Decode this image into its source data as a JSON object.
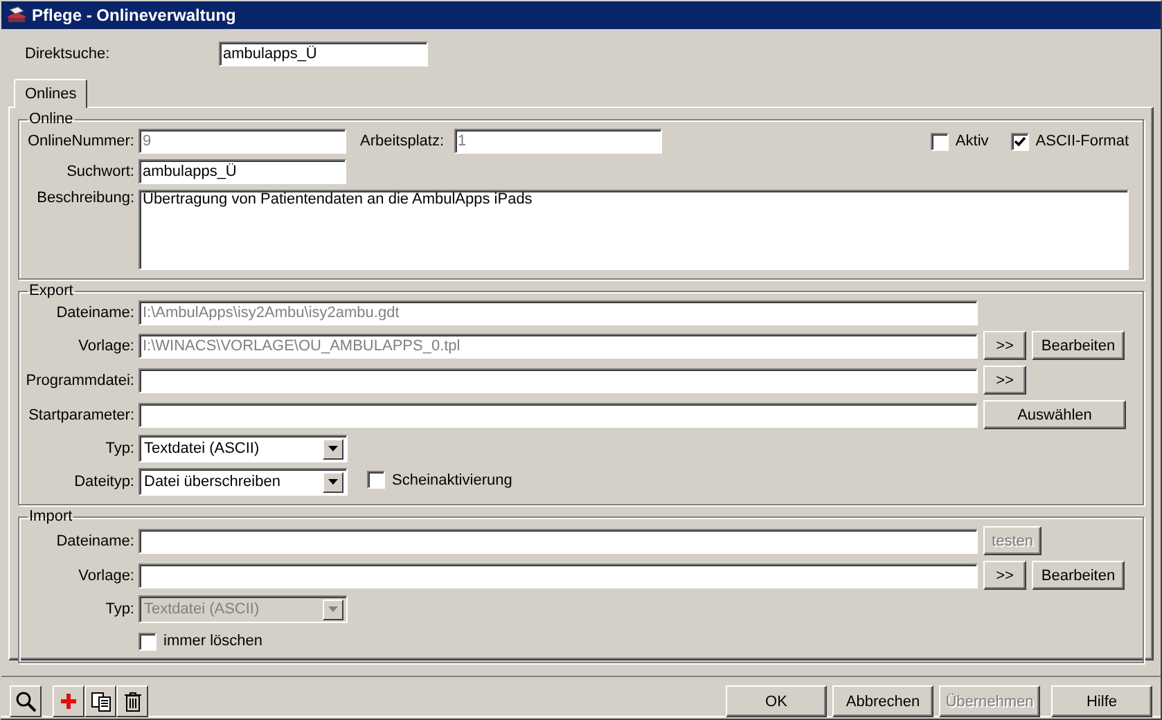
{
  "window": {
    "title": "Pflege - Onlineverwaltung"
  },
  "direct_search": {
    "label": "Direktsuche:",
    "value": "ambulapps_Ü"
  },
  "tabs": [
    {
      "label": "Onlines",
      "selected": true
    }
  ],
  "online": {
    "title": "Online",
    "number": {
      "label": "OnlineNummer:",
      "value": "9",
      "disabled": true
    },
    "workplace": {
      "label": "Arbeitsplatz:",
      "value": "1",
      "disabled": true
    },
    "checkboxes": [
      {
        "label": "Aktiv",
        "checked": false
      },
      {
        "label": "ASCII-Format",
        "checked": true
      }
    ],
    "keyword": {
      "label": "Suchwort:",
      "value": "ambulapps_Ü",
      "disabled": false
    },
    "description": {
      "label": "Beschreibung:",
      "value": "Übertragung von Patientendaten an die AmbulApps iPads"
    }
  },
  "export": {
    "title": "Export",
    "rows": [
      {
        "kind": "text",
        "label": "Dateiname:",
        "value": "I:\\AmbulApps\\isy2Ambu\\isy2ambu.gdt",
        "disabled": true,
        "buttons": []
      },
      {
        "kind": "text",
        "label": "Vorlage:",
        "value": "I:\\WINACS\\VORLAGE\\OU_AMBULAPPS_0.tpl",
        "disabled": true,
        "buttons": [
          {
            "label": ">>",
            "kind": "browse",
            "disabled": false
          },
          {
            "label": "Bearbeiten",
            "kind": "action",
            "disabled": false
          }
        ]
      },
      {
        "kind": "text",
        "label": "Programmdatei:",
        "value": "",
        "buttons": [
          {
            "label": ">>",
            "kind": "browse",
            "disabled": false
          }
        ]
      },
      {
        "kind": "text",
        "label": "Startparameter:",
        "value": "",
        "buttons": [
          {
            "label": "Auswählen",
            "kind": "wide",
            "disabled": false
          }
        ]
      },
      {
        "kind": "select",
        "label": "Typ:",
        "value": "Textdatei (ASCII)",
        "disabled": false
      },
      {
        "kind": "select",
        "label": "Dateityp:",
        "value": "Datei überschreiben",
        "disabled": false,
        "checkbox": {
          "label": "Scheinaktivierung",
          "checked": false
        }
      }
    ]
  },
  "import": {
    "title": "Import",
    "rows": [
      {
        "kind": "text",
        "label": "Dateiname:",
        "value": "",
        "buttons": [
          {
            "label": "testen",
            "kind": "test",
            "disabled": true
          }
        ]
      },
      {
        "kind": "text",
        "label": "Vorlage:",
        "value": "",
        "buttons": [
          {
            "label": ">>",
            "kind": "browse",
            "disabled": false
          },
          {
            "label": "Bearbeiten",
            "kind": "action",
            "disabled": false
          }
        ]
      },
      {
        "kind": "select",
        "label": "Typ:",
        "value": "Textdatei (ASCII)",
        "disabled": true
      },
      {
        "kind": "checkbox",
        "label": "immer löschen",
        "checked": false
      }
    ]
  },
  "buttons": [
    {
      "label": "OK",
      "disabled": false
    },
    {
      "label": "Abbrechen",
      "disabled": false
    },
    {
      "label": "Übernehmen",
      "disabled": true
    },
    {
      "label": "Hilfe",
      "disabled": false
    }
  ]
}
